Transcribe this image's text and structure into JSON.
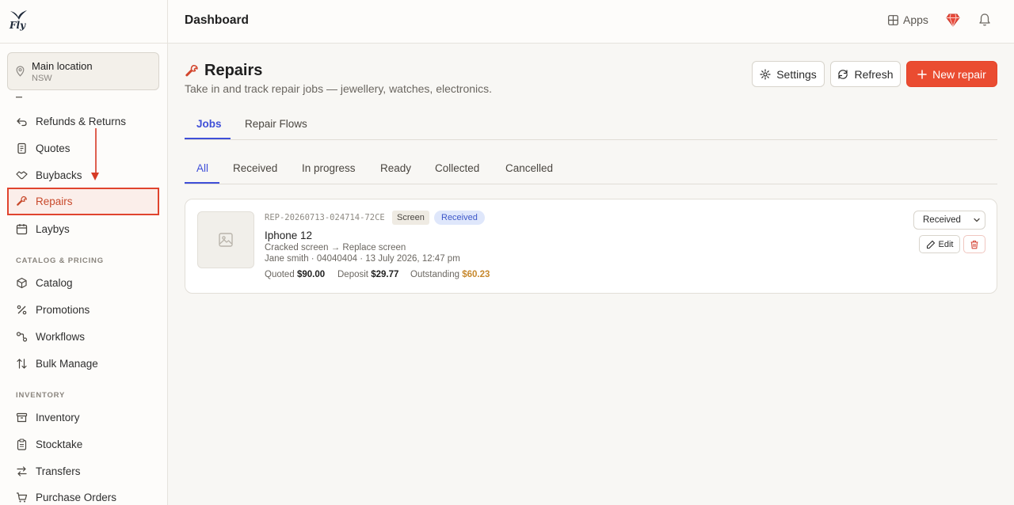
{
  "brand": {
    "logo_text": "Fly"
  },
  "location": {
    "name": "Main location",
    "state": "NSW"
  },
  "sidebar": {
    "items": [
      {
        "label": "Refunds & Returns",
        "icon": "undo-icon"
      },
      {
        "label": "Quotes",
        "icon": "document-icon"
      },
      {
        "label": "Buybacks",
        "icon": "handshake-icon"
      },
      {
        "label": "Repairs",
        "icon": "wrench-icon",
        "active": true
      },
      {
        "label": "Laybys",
        "icon": "calendar-icon"
      },
      {
        "label": "Catalog",
        "icon": "box-icon"
      },
      {
        "label": "Promotions",
        "icon": "percent-icon"
      },
      {
        "label": "Workflows",
        "icon": "workflow-icon"
      },
      {
        "label": "Bulk Manage",
        "icon": "sort-arrows-icon"
      },
      {
        "label": "Inventory",
        "icon": "archive-icon"
      },
      {
        "label": "Stocktake",
        "icon": "clipboard-icon"
      },
      {
        "label": "Transfers",
        "icon": "transfer-icon"
      },
      {
        "label": "Purchase Orders",
        "icon": "cart-icon"
      }
    ],
    "sections": {
      "catalog": "CATALOG & PRICING",
      "inventory": "INVENTORY"
    }
  },
  "header": {
    "title": "Dashboard",
    "apps_label": "Apps"
  },
  "page": {
    "title": "Repairs",
    "subtitle": "Take in and track repair jobs — jewellery, watches, electronics.",
    "buttons": {
      "settings": "Settings",
      "refresh": "Refresh",
      "new": "New repair"
    }
  },
  "tabs": [
    "Jobs",
    "Repair Flows"
  ],
  "filter_tabs": [
    "All",
    "Received",
    "In progress",
    "Ready",
    "Collected",
    "Cancelled"
  ],
  "job": {
    "id": "REP-20260713-024714-72CE",
    "category": "Screen",
    "status": "Received",
    "name": "Iphone 12",
    "issue": "Cracked screen → Replace screen",
    "customer_line": "Jane smith · 04040404 · 13 July 2026, 12:47 pm",
    "quoted_label": "Quoted",
    "quoted": "$90.00",
    "deposit_label": "Deposit",
    "deposit": "$29.77",
    "outstanding_label": "Outstanding",
    "outstanding": "$60.23",
    "status_select": "Received",
    "edit_label": "Edit"
  },
  "colors": {
    "accent": "#3f4fd8",
    "primary": "#ea4c31",
    "highlight": "#e0442e",
    "warning": "#c7892e"
  }
}
